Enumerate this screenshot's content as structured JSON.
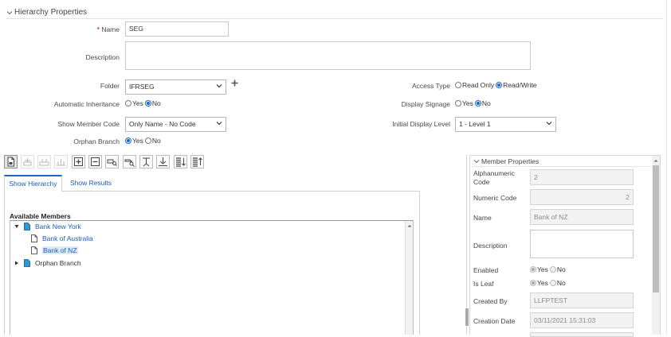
{
  "section": {
    "title": "Hierarchy Properties"
  },
  "form": {
    "name": {
      "label": "Name",
      "required_mark": "*",
      "value": "SEG"
    },
    "description": {
      "label": "Description",
      "value": ""
    },
    "folder": {
      "label": "Folder",
      "value": "IFRSEG"
    },
    "automatic_inheritance": {
      "label": "Automatic Inheritance",
      "options": [
        "Yes",
        "No"
      ],
      "selected": "No"
    },
    "show_member_code": {
      "label": "Show Member Code",
      "value": "Only Name - No Code"
    },
    "orphan_branch": {
      "label": "Orphan Branch",
      "options": [
        "Yes",
        "No"
      ],
      "selected": "Yes"
    },
    "access_type": {
      "label": "Access Type",
      "options": [
        "Read Only",
        "Read/Write"
      ],
      "selected": "Read/Write"
    },
    "display_signage": {
      "label": "Display Signage",
      "options": [
        "Yes",
        "No"
      ],
      "selected": "No"
    },
    "initial_display_level": {
      "label": "Initial Display Level",
      "value": "1 - Level 1"
    }
  },
  "tabs": [
    {
      "label": "Show Hierarchy",
      "active": true
    },
    {
      "label": "Show Results",
      "active": false
    }
  ],
  "tree": {
    "header": "Available Members",
    "items": [
      {
        "label": "Bank New York",
        "level": 0,
        "expanded": true,
        "type": "folder"
      },
      {
        "label": "Bank of Australia",
        "level": 1,
        "type": "leaf"
      },
      {
        "label": "Bank of NZ",
        "level": 1,
        "type": "leaf",
        "selected": true
      },
      {
        "label": "Orphan Branch",
        "level": 0,
        "expanded": false,
        "type": "folder"
      }
    ]
  },
  "member_properties": {
    "title": "Member Properties",
    "alphanumeric_code": {
      "label": "Alphanumeric Code",
      "value": "2"
    },
    "numeric_code": {
      "label": "Numeric Code",
      "value": "2"
    },
    "name": {
      "label": "Name",
      "value": "Bank of NZ"
    },
    "description": {
      "label": "Description",
      "value": ""
    },
    "enabled": {
      "label": "Enabled",
      "options": [
        "Yes",
        "No"
      ],
      "selected": "Yes"
    },
    "is_leaf": {
      "label": "Is Leaf",
      "options": [
        "Yes",
        "No"
      ],
      "selected": "Yes"
    },
    "created_by": {
      "label": "Created By",
      "value": "LLFPTEST"
    },
    "creation_date": {
      "label": "Creation Date",
      "value": "03/11/2021 15:31:03"
    }
  },
  "colors": {
    "accent": "#1a66c9",
    "link": "#1a5fb4",
    "tab_active": "#1a66c9"
  }
}
